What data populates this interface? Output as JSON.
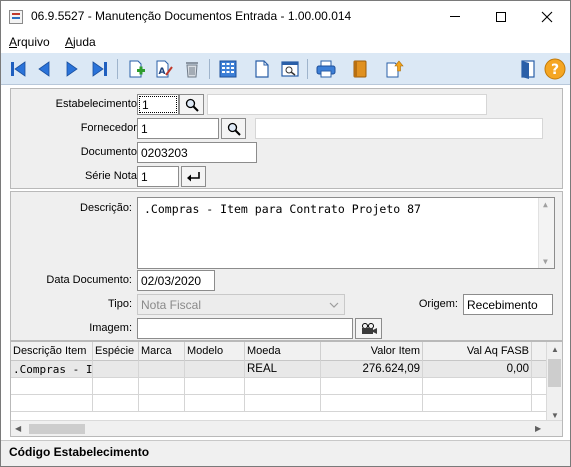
{
  "window": {
    "title": "06.9.5527 - Manutenção Documentos Entrada - 1.00.00.014"
  },
  "menu": {
    "items": [
      {
        "label": "Arquivo"
      },
      {
        "label": "Ajuda"
      }
    ]
  },
  "toolbar": {
    "buttons": [
      {
        "icon": "first-record-icon"
      },
      {
        "icon": "previous-record-icon"
      },
      {
        "icon": "next-record-icon"
      },
      {
        "icon": "last-record-icon"
      },
      {
        "icon": "add-record-icon"
      },
      {
        "icon": "edit-record-icon"
      },
      {
        "icon": "delete-record-icon"
      },
      {
        "icon": "calculator-icon"
      },
      {
        "icon": "blank-document-icon"
      },
      {
        "icon": "zoom-window-icon"
      },
      {
        "icon": "printer-icon"
      },
      {
        "icon": "book-icon"
      },
      {
        "icon": "document-upload-icon"
      },
      {
        "icon": "exit-door-icon"
      },
      {
        "icon": "help-icon"
      }
    ]
  },
  "header": {
    "estabelecimento": {
      "label": "Estabelecimento:",
      "value": "1",
      "description": ""
    },
    "fornecedor": {
      "label": "Fornecedor:",
      "value": "1",
      "description": ""
    },
    "documento": {
      "label": "Documento:",
      "value": "0203203"
    },
    "serie_nota": {
      "label": "Série Nota:",
      "value": "1"
    }
  },
  "details": {
    "descricao": {
      "label": "Descrição:",
      "value": ".Compras - Item para Contrato Projeto 87"
    },
    "data_documento": {
      "label": "Data Documento:",
      "value": "02/03/2020"
    },
    "tipo": {
      "label": "Tipo:",
      "value": "Nota Fiscal"
    },
    "origem": {
      "label": "Origem:",
      "value": "Recebimento"
    },
    "imagem": {
      "label": "Imagem:",
      "value": ""
    }
  },
  "grid": {
    "columns": [
      "Descrição Item",
      "Espécie",
      "Marca",
      "Modelo",
      "Moeda",
      "Valor Item",
      "Val Aq FASB"
    ],
    "rows": [
      [
        ".Compras - It",
        "",
        "",
        "",
        "REAL",
        "276.624,09",
        "0,00"
      ]
    ]
  },
  "status": {
    "text": "Código Estabelecimento"
  }
}
